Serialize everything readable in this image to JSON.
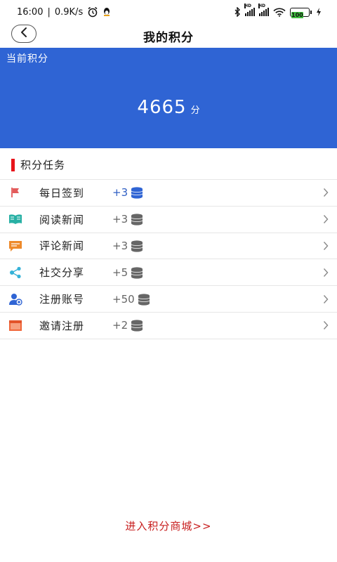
{
  "status": {
    "time": "16:00",
    "speed": "0.9K/s",
    "battery": "100"
  },
  "nav": {
    "title": "我的积分"
  },
  "points": {
    "label": "当前积分",
    "value": "4665",
    "unit": "分"
  },
  "section": {
    "title": "积分任务"
  },
  "tasks": [
    {
      "name": "每日签到",
      "reward": "+3",
      "icon": "flag-icon",
      "icon_color": "#e35b5b",
      "reward_color": "#2f5fc4",
      "coin_color": "#2f64d4"
    },
    {
      "name": "阅读新闻",
      "reward": "+3",
      "icon": "book-icon",
      "icon_color": "#27b0a4",
      "reward_color": "#666666",
      "coin_color": "#666666"
    },
    {
      "name": "评论新闻",
      "reward": "+3",
      "icon": "comment-icon",
      "icon_color": "#ee8a2b",
      "reward_color": "#666666",
      "coin_color": "#666666"
    },
    {
      "name": "社交分享",
      "reward": "+5",
      "icon": "share-icon",
      "icon_color": "#35b2d8",
      "reward_color": "#666666",
      "coin_color": "#666666"
    },
    {
      "name": "注册账号",
      "reward": "+50",
      "icon": "add-user-icon",
      "icon_color": "#2f64d4",
      "reward_color": "#666666",
      "coin_color": "#666666"
    },
    {
      "name": "邀请注册",
      "reward": "+2",
      "icon": "invite-icon",
      "icon_color": "#f0673a",
      "reward_color": "#666666",
      "coin_color": "#666666"
    }
  ],
  "footer": {
    "mall_link": "进入积分商城>>"
  },
  "colors": {
    "banner": "#2f64d4",
    "section_accent": "#e8141b",
    "mall_link": "#c71d1d"
  }
}
